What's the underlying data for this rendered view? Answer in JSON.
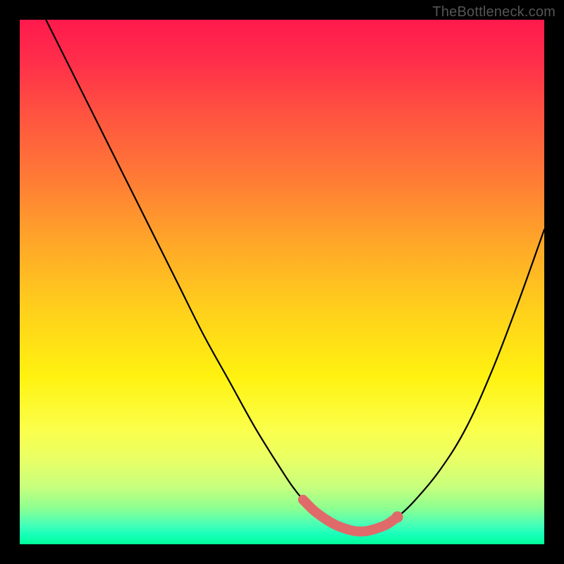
{
  "watermark": "TheBottleneck.com",
  "chart_data": {
    "type": "line",
    "title": "",
    "xlabel": "",
    "ylabel": "",
    "xlim": [
      0,
      100
    ],
    "ylim": [
      0,
      100
    ],
    "grid": false,
    "series": [
      {
        "name": "black-curve",
        "color": "#000000",
        "x": [
          5,
          10,
          15,
          20,
          25,
          30,
          35,
          40,
          45,
          50,
          52,
          54,
          56,
          58,
          60,
          62,
          64,
          66,
          68,
          70,
          72,
          75,
          80,
          85,
          90,
          95,
          100
        ],
        "y": [
          100,
          90,
          80,
          70,
          60,
          50,
          40,
          31,
          22,
          14,
          11,
          8.5,
          6.5,
          5,
          3.8,
          3,
          2.5,
          2.5,
          3,
          3.8,
          5.2,
          8,
          14,
          22,
          33,
          46,
          60
        ]
      },
      {
        "name": "highlight-band",
        "color": "#e57373",
        "x": [
          54,
          56,
          58,
          60,
          62,
          64,
          66,
          68,
          70,
          72
        ],
        "y": [
          8.5,
          6.5,
          5,
          3.8,
          3,
          2.5,
          2.5,
          3,
          3.8,
          5.2
        ]
      }
    ],
    "gradient": {
      "direction": "vertical",
      "stops": [
        {
          "pos": 0,
          "color": "#ff1a4d"
        },
        {
          "pos": 0.3,
          "color": "#ff7a36"
        },
        {
          "pos": 0.55,
          "color": "#ffcf1c"
        },
        {
          "pos": 0.78,
          "color": "#fbff4a"
        },
        {
          "pos": 0.93,
          "color": "#8fff8f"
        },
        {
          "pos": 1,
          "color": "#00ff99"
        }
      ]
    }
  }
}
